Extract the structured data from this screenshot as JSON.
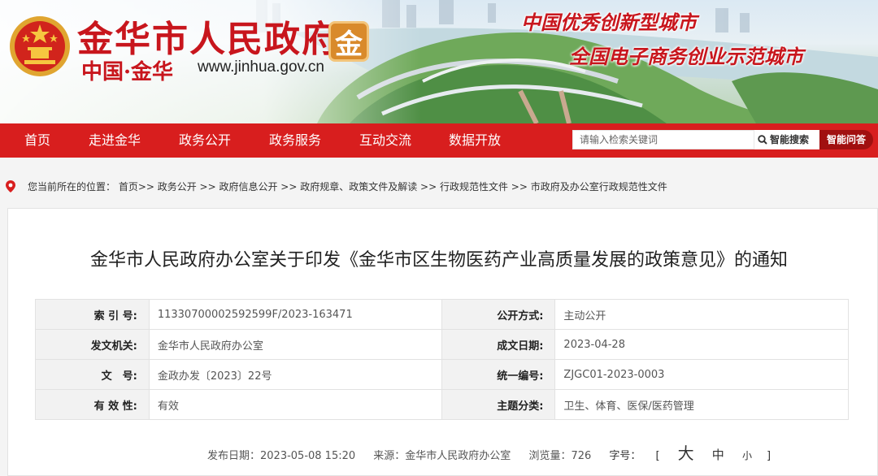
{
  "header": {
    "site_title": "金华市人民政府",
    "seal_char": "金",
    "sub_cn": "中国·金华",
    "sub_url": "www.jinhua.gov.cn",
    "slogan1": "中国优秀创新型城市",
    "slogan2": "全国电子商务创业示范城市"
  },
  "nav": {
    "items": [
      "首页",
      "走进金华",
      "政务公开",
      "政务服务",
      "互动交流",
      "数据开放"
    ]
  },
  "search": {
    "placeholder": "请输入检索关键词",
    "button": "智能搜索",
    "qa_button": "智能问答"
  },
  "breadcrumb": {
    "text": "您当前所在的位置： 首页>> 政务公开 >> 政府信息公开 >> 政府规章、政策文件及解读 >> 行政规范性文件 >> 市政府及办公室行政规范性文件"
  },
  "article": {
    "title": "金华市人民政府办公室关于印发《金华市区生物医药产业高质量发展的政策意见》的通知",
    "meta": {
      "index_label": "索 引 号:",
      "index_value": "11330700002592599F/2023-163471",
      "public_label": "公开方式:",
      "public_value": "主动公开",
      "issuer_label": "发文机关:",
      "issuer_value": "金华市人民政府办公室",
      "date_label": "成文日期:",
      "date_value": "2023-04-28",
      "doc_label": "文　号:",
      "doc_value": "金政办发〔2023〕22号",
      "unified_label": "统一编号:",
      "unified_value": "ZJGC01-2023-0003",
      "validity_label": "有 效 性:",
      "validity_value": "有效",
      "topic_label": "主题分类:",
      "topic_value": "卫生、体育、医保/医药管理"
    },
    "footer": {
      "publish": "发布日期：2023-05-08 15:20",
      "source": "来源：金华市人民政府办公室",
      "views": "浏览量：726",
      "font_label": "字号：",
      "bracket_open": "[",
      "size_big": "大",
      "size_mid": "中",
      "size_small": "小",
      "bracket_close": "]"
    }
  },
  "colors": {
    "brand_red": "#d81e1e",
    "title_red": "#c8161d",
    "qa_red": "#a11010"
  }
}
